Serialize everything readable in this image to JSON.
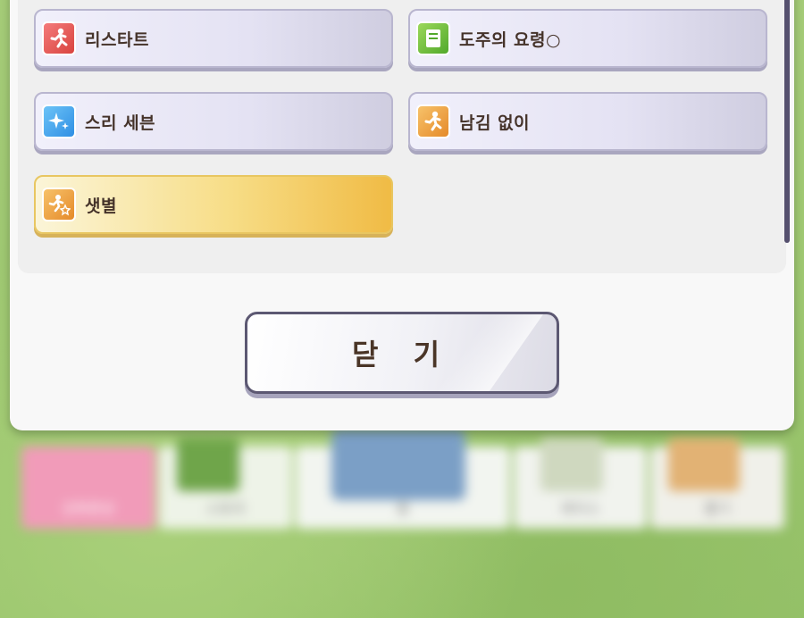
{
  "skills": [
    {
      "label": "리스타트",
      "icon": "running-figure-icon",
      "color": "#d9443f"
    },
    {
      "label": "도주의 요령○",
      "icon": "notebook-icon",
      "color": "#52a92b"
    },
    {
      "label": "스리 세븐",
      "icon": "sparkle-icon",
      "color": "#2f8fe4"
    },
    {
      "label": "남김 없이",
      "icon": "running-figure-icon",
      "color": "#e58a29"
    },
    {
      "label": "샛별",
      "icon": "star-runner-icon",
      "color": "#e58a29",
      "highlight": "gold"
    }
  ],
  "close_button": {
    "label": "닫 기"
  },
  "background_menu": {
    "items": [
      "강화편성",
      "스토리",
      "홈",
      "레이스",
      "뽑기"
    ]
  }
}
